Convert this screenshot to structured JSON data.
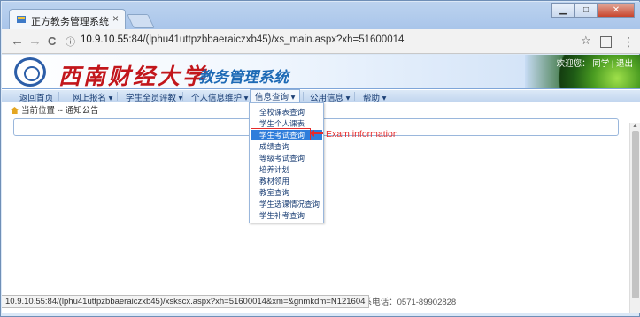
{
  "browser": {
    "tab_title": "正方教务管理系统",
    "tab_close": "×",
    "url_host": "10.9.10.55",
    "url_path": ":84/(lphu41uttpzbbaeraiczxb45)/xs_main.aspx?xh=51600014",
    "info_glyph": "ⓘ",
    "star_glyph": "☆",
    "menu_glyph": "⋮",
    "back_glyph": "←",
    "forward_glyph": "→",
    "reload_glyph": "C",
    "window_buttons": {
      "minimize": "▁",
      "maximize": "□",
      "close": "✕"
    },
    "status_url": "10.9.10.55:84/(lphu41uttpzbbaeraiczxb45)/xskscx.aspx?xh=51600014&xm=&gnmkdm=N121604"
  },
  "header": {
    "university": "西南财经大学",
    "system_name": "教务管理系统",
    "user_welcome": "欢迎您：",
    "user_name": "同学",
    "logout": "退出"
  },
  "nav": {
    "items": [
      {
        "label": "返回首页"
      },
      {
        "label": "网上报名 ▾"
      },
      {
        "label": "学生全员评教 ▾"
      },
      {
        "label": "个人信息维护 ▾"
      },
      {
        "label": "信息查询 ▾"
      },
      {
        "label": "公用信息 ▾"
      },
      {
        "label": "帮助 ▾"
      }
    ]
  },
  "breadcrumb": {
    "text": "当前位置 -- 通知公告"
  },
  "dropdown": {
    "items": [
      "全校课表查询",
      "学生个人课表",
      "学生考试查询",
      "成绩查询",
      "等级考试查询",
      "培养计划",
      "教材领用",
      "教室查询",
      "学生选课情况查询",
      "学生补考查询"
    ],
    "selected_index": 2
  },
  "annotation": {
    "label": "Exam information",
    "color": "#e62b2b"
  },
  "footer": {
    "text": "权所有  联系电话：0571-89902828"
  },
  "colors": {
    "nav_text": "#1b3f75",
    "brand_red": "#c2161b",
    "brand_blue": "#1d6ab5",
    "selection": "#2f7ddb"
  }
}
